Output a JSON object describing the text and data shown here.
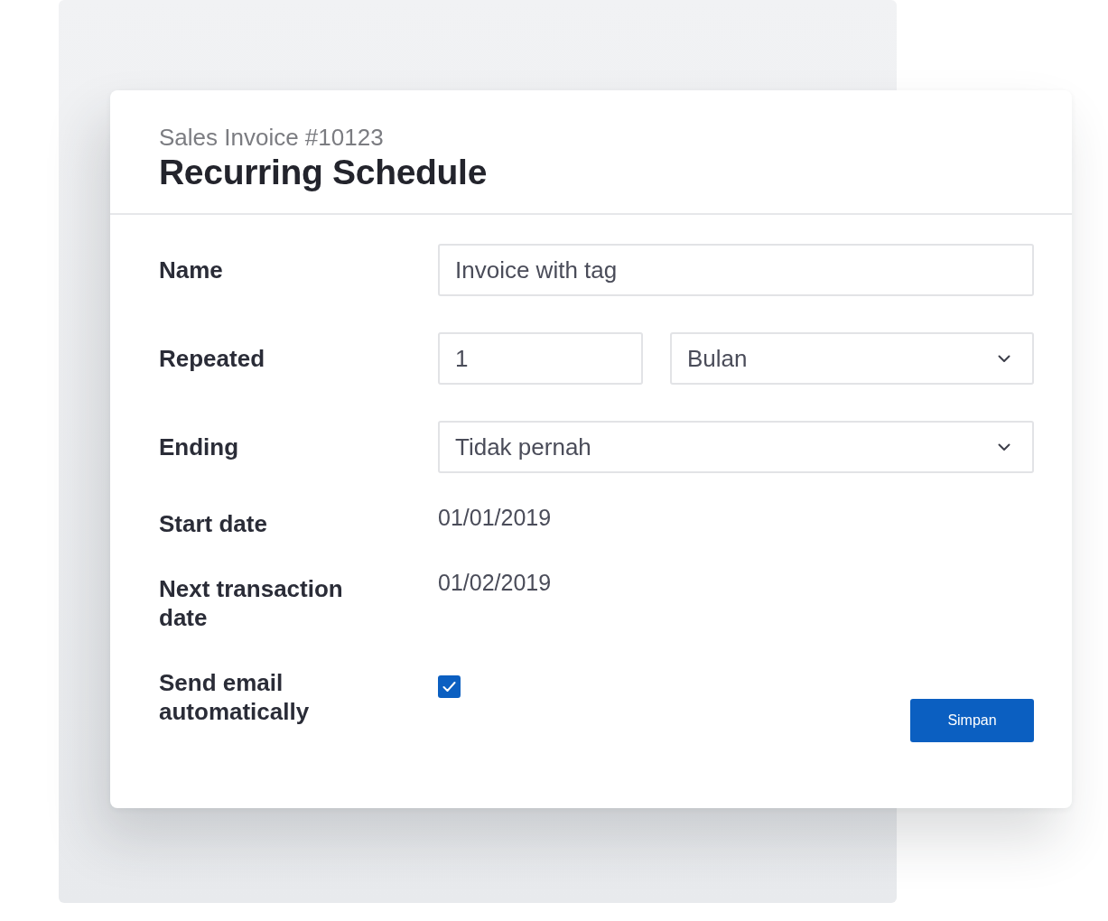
{
  "header": {
    "subtitle": "Sales Invoice #10123",
    "title": "Recurring Schedule"
  },
  "fields": [
    {
      "label": "Name",
      "controls": [
        {
          "kind": "input",
          "value": "Invoice with tag"
        }
      ]
    },
    {
      "label": "Repeated",
      "controls": [
        {
          "kind": "input",
          "value": "1"
        },
        {
          "kind": "select",
          "value": "Bulan"
        }
      ]
    },
    {
      "label": "Ending",
      "controls": [
        {
          "kind": "select",
          "value": "Tidak pernah"
        }
      ]
    },
    {
      "label": "Start date",
      "controls": [
        {
          "kind": "text",
          "value": "01/01/2019"
        }
      ]
    },
    {
      "label": "Next transaction date",
      "controls": [
        {
          "kind": "text",
          "value": "01/02/2019"
        }
      ]
    },
    {
      "label": "Send email automatically",
      "controls": [
        {
          "kind": "checkbox",
          "checked": true
        }
      ]
    }
  ],
  "save_button": {
    "label": "Simpan"
  }
}
